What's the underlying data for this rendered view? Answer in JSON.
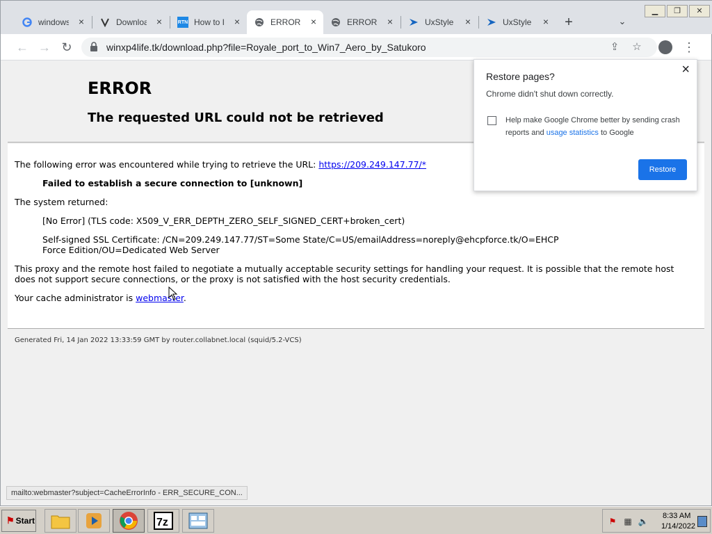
{
  "tabs": [
    {
      "title": "windows",
      "icon": "google-icon"
    },
    {
      "title": "Download",
      "icon": "download-site-icon"
    },
    {
      "title": "How to In",
      "icon": "rtn-icon"
    },
    {
      "title": "ERROR: T",
      "icon": "globe-icon"
    },
    {
      "title": "ERROR: T",
      "icon": "globe-icon"
    },
    {
      "title": "UxStyle is",
      "icon": "uxstyle-icon"
    },
    {
      "title": "UxStyle is",
      "icon": "uxstyle-icon"
    }
  ],
  "active_tab": 3,
  "address_bar": {
    "url": "winxp4life.tk/download.php?file=Royale_port_to_Win7_Aero_by_Satukoro"
  },
  "page": {
    "heading": "ERROR",
    "subheading": "The requested URL could not be retrieved",
    "line1_prefix": "The following error was encountered while trying to retrieve the URL: ",
    "line1_link": "https://209.249.147.77/*",
    "failed": "Failed to establish a secure connection to [unknown]",
    "system_returned": "The system returned:",
    "tls_code": "[No Error] (TLS code: X509_V_ERR_DEPTH_ZERO_SELF_SIGNED_CERT+broken_cert)",
    "cert": "Self-signed SSL Certificate: /CN=209.249.147.77/ST=Some State/C=US/emailAddress=noreply@ehcpforce.tk/O=EHCP Force Edition/OU=Dedicated Web Server",
    "proxy_msg": "This proxy and the remote host failed to negotiate a mutually acceptable security settings for handling your request. It is possible that the remote host does not support secure connections, or the proxy is not satisfied with the host security credentials.",
    "cache_prefix": "Your cache administrator is ",
    "cache_link": "webmaster",
    "cache_suffix": ".",
    "footer": "Generated Fri, 14 Jan 2022 13:33:59 GMT by router.collabnet.local (squid/5.2-VCS)"
  },
  "status_bar": "mailto:webmaster?subject=CacheErrorInfo - ERR_SECURE_CON...",
  "popup": {
    "title": "Restore pages?",
    "message": "Chrome didn't shut down correctly.",
    "crash_prefix": "Help make Google Chrome better by sending crash reports and ",
    "crash_link": "usage statistics",
    "crash_suffix": " to Google",
    "crash_checked": false,
    "restore_label": "Restore"
  },
  "taskbar": {
    "start_label": "Start",
    "apps": [
      "folder-icon",
      "media-player-icon",
      "chrome-icon",
      "7zip-icon",
      "control-panel-icon"
    ],
    "clock_time": "8:33 AM",
    "clock_date": "1/14/2022"
  },
  "colors": {
    "link": "#0000ee",
    "chrome_blue": "#1a73e8",
    "tabstrip": "#dee1e6"
  }
}
